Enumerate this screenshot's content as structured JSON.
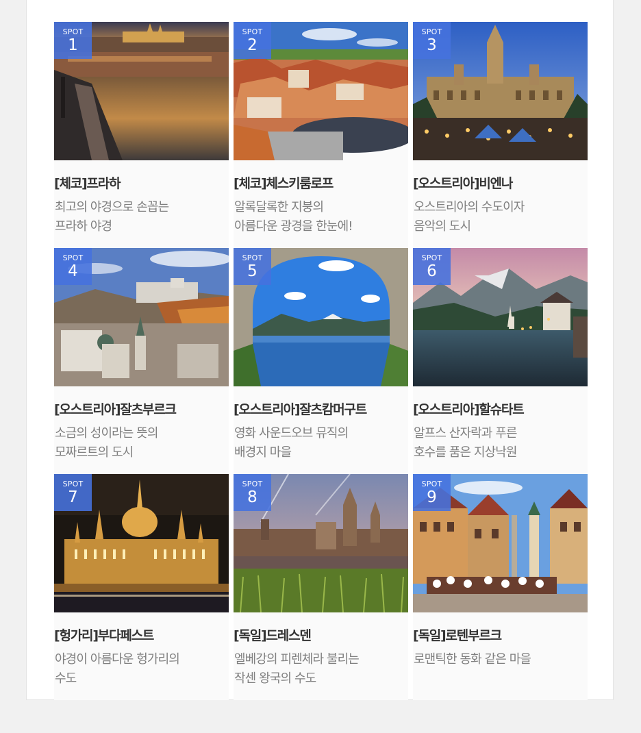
{
  "spots": [
    {
      "badge_label": "SPOT",
      "number": "1",
      "title": "[체코]프라하",
      "desc_line1": "최고의 야경으로 손꼽는",
      "desc_line2": "프라하 야경",
      "photo": "prague-night-view-photo"
    },
    {
      "badge_label": "SPOT",
      "number": "2",
      "title": "[체코]체스키룸로프",
      "desc_line1": "알록달록한 지붕의",
      "desc_line2": "아름다운 광경을 한눈에!",
      "photo": "cesky-krumlov-rooftops-photo"
    },
    {
      "badge_label": "SPOT",
      "number": "3",
      "title": "[오스트리아]비엔나",
      "desc_line1": "오스트리아의 수도이자",
      "desc_line2": "음악의 도시",
      "photo": "vienna-city-hall-market-photo"
    },
    {
      "badge_label": "SPOT",
      "number": "4",
      "title": "[오스트리아]잘츠부르크",
      "desc_line1": "소금의 성이라는 뜻의",
      "desc_line2": "모짜르트의 도시",
      "photo": "salzburg-fortress-photo"
    },
    {
      "badge_label": "SPOT",
      "number": "5",
      "title": "[오스트리아]잘츠캄머구트",
      "desc_line1": "영화 사운드오브 뮤직의",
      "desc_line2": "배경지 마을",
      "photo": "salzkammergut-lake-arch-photo"
    },
    {
      "badge_label": "SPOT",
      "number": "6",
      "title": "[오스트리아]할슈타트",
      "desc_line1": "알프스 산자락과 푸른",
      "desc_line2": "호수를 품은 지상낙원",
      "photo": "hallstatt-lake-village-photo"
    },
    {
      "badge_label": "SPOT",
      "number": "7",
      "title": "[헝가리]부다페스트",
      "desc_line1": "야경이 아름다운 헝가리의",
      "desc_line2": "수도",
      "photo": "budapest-parliament-night-photo"
    },
    {
      "badge_label": "SPOT",
      "number": "8",
      "title": "[독일]드레스덴",
      "desc_line1": "엘베강의 피렌체라 불리는",
      "desc_line2": "작센 왕국의 수도",
      "photo": "dresden-skyline-photo"
    },
    {
      "badge_label": "SPOT",
      "number": "9",
      "title": "[독일]로텐부르크",
      "desc_line1": "로맨틱한 동화 같은 마을",
      "desc_line2": "",
      "photo": "rothenburg-town-square-photo"
    }
  ],
  "colors": {
    "badge": "#4672de",
    "title": "#333333",
    "desc": "#808080",
    "page_bg": "#f1f1f1"
  }
}
